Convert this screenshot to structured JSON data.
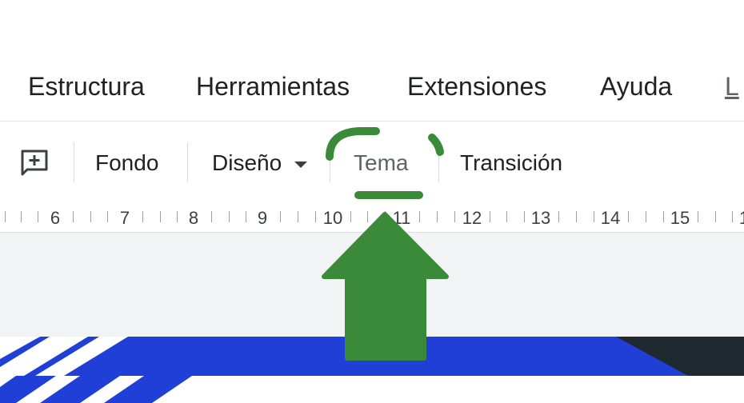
{
  "menu": {
    "items": [
      {
        "id": "estructura",
        "label": "Estructura"
      },
      {
        "id": "herramientas",
        "label": "Herramientas"
      },
      {
        "id": "extensiones",
        "label": "Extensiones"
      },
      {
        "id": "ayuda",
        "label": "Ayuda"
      }
    ],
    "cut_off_label": "L"
  },
  "toolbar": {
    "add_comment_icon": "add-comment-icon",
    "fondo_label": "Fondo",
    "diseno_label": "Diseño",
    "tema_label": "Tema",
    "transicion_label": "Transición"
  },
  "ruler": {
    "labels": [
      "6",
      "7",
      "8",
      "9",
      "10",
      "11",
      "12",
      "13",
      "14",
      "15",
      "1"
    ]
  },
  "annotation": {
    "color": "#3a8a3a",
    "arrow": "up-arrow",
    "highlight": "dashed-circle"
  },
  "colors": {
    "slide_blue": "#1f3fd6",
    "slide_dark": "#1e2a30",
    "canvas_bg": "#f1f3f4"
  }
}
